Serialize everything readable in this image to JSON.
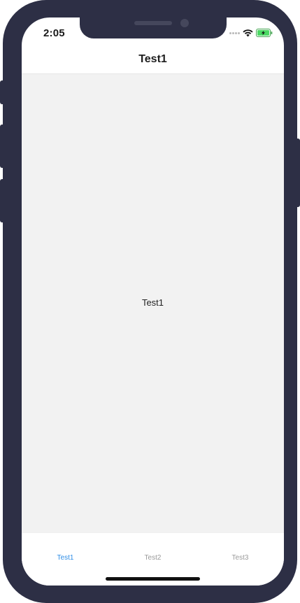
{
  "status_bar": {
    "time": "2:05",
    "icons": [
      "signal-dots-icon",
      "wifi-icon",
      "battery-charging-icon"
    ],
    "battery_color": "#4cd964"
  },
  "nav": {
    "title": "Test1"
  },
  "content": {
    "label": "Test1"
  },
  "tabs": [
    {
      "label": "Test1",
      "active": true
    },
    {
      "label": "Test2",
      "active": false
    },
    {
      "label": "Test3",
      "active": false
    }
  ],
  "colors": {
    "frame": "#2d2f45",
    "content_bg": "#f2f2f2",
    "active_tab": "#2f8ee6",
    "inactive_tab": "#9a9a9a"
  }
}
